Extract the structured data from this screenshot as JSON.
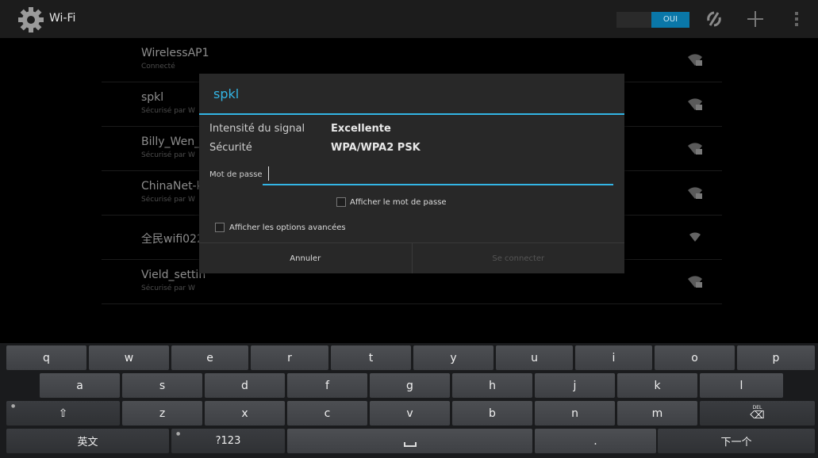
{
  "actionbar": {
    "title": "Wi-Fi",
    "switch_label": "OUI",
    "icons": [
      "gear-icon",
      "wifi-scan-icon",
      "add-icon",
      "overflow-menu-icon"
    ]
  },
  "networks": [
    {
      "name": "WirelessAP1",
      "status": "Connecté",
      "secured": true
    },
    {
      "name": "spkl",
      "status": "Sécurisé par W",
      "secured": true
    },
    {
      "name": "Billy_Wen_C",
      "status": "Sécurisé par W",
      "secured": true
    },
    {
      "name": "ChinaNet-k",
      "status": "Sécurisé par W",
      "secured": true
    },
    {
      "name": "全民wifi022",
      "status": "",
      "secured": false
    },
    {
      "name": "Vield_settin",
      "status": "Sécurisé par W",
      "secured": true
    }
  ],
  "dialog": {
    "title": "spkl",
    "signal_label": "Intensité du signal",
    "signal_value": "Excellente",
    "security_label": "Sécurité",
    "security_value": "WPA/WPA2 PSK",
    "password_label": "Mot de passe",
    "password_value": "",
    "show_password_label": "Afficher le mot de passe",
    "advanced_label": "Afficher les options avancées",
    "cancel_label": "Annuler",
    "connect_label": "Se connecter"
  },
  "keyboard": {
    "row1": [
      "q",
      "w",
      "e",
      "r",
      "t",
      "y",
      "u",
      "i",
      "o",
      "p"
    ],
    "row2": [
      "a",
      "s",
      "d",
      "f",
      "g",
      "h",
      "j",
      "k",
      "l"
    ],
    "row3": [
      "⇧",
      "z",
      "x",
      "c",
      "v",
      "b",
      "n",
      "m",
      "⌫"
    ],
    "del_label": "DEL",
    "lang_label": "英文",
    "symbols_label": "?123",
    "period_label": ".",
    "next_label": "下一个"
  },
  "colors": {
    "accent": "#33b5e5",
    "switch_on": "#0a77a8"
  }
}
